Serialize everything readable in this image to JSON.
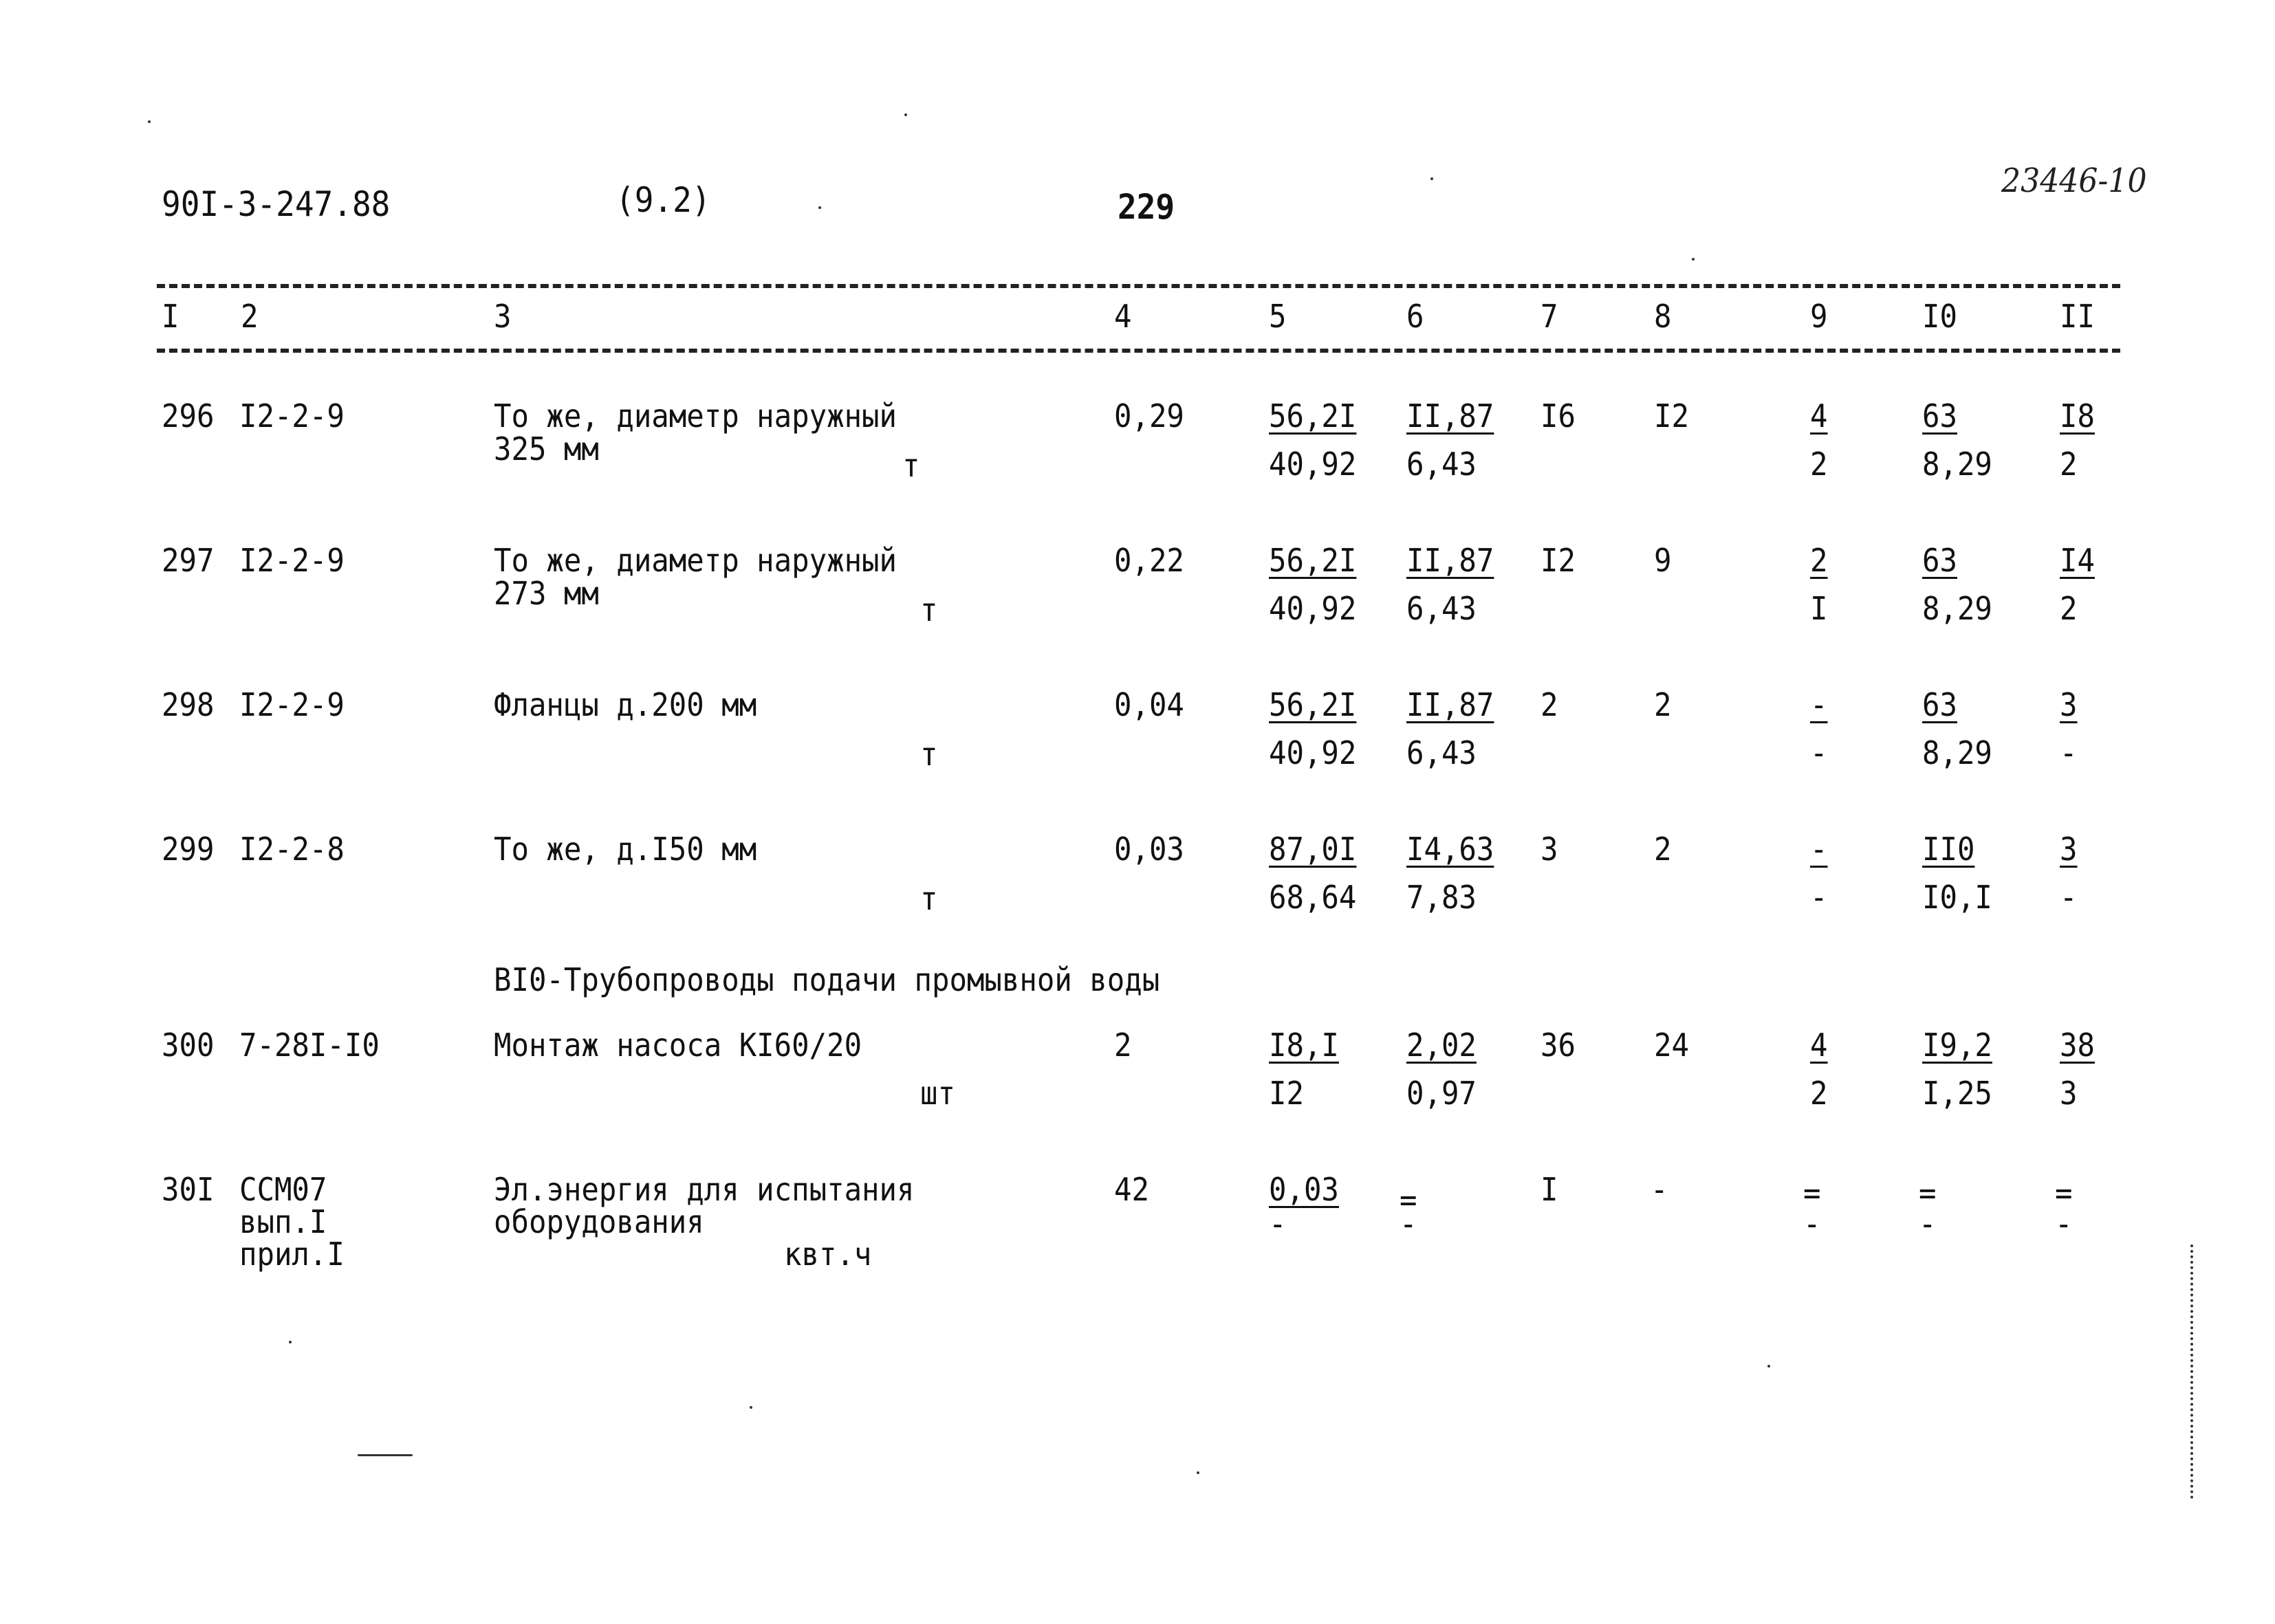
{
  "document": {
    "code": "90I-3-247.88",
    "section_ref": "(9.2)",
    "page_number": "229",
    "stamp": "23446-10"
  },
  "columns": [
    "I",
    "2",
    "3",
    "4",
    "5",
    "6",
    "7",
    "8",
    "9",
    "I0",
    "II"
  ],
  "rows": [
    {
      "num": "296",
      "ref": [
        "I2-2-9"
      ],
      "desc": [
        "То же, диаметр наружный",
        "325 мм"
      ],
      "unit": "т",
      "qty": "0,29",
      "c5": [
        "56,2I",
        "40,92"
      ],
      "c6": [
        "II,87",
        "6,43"
      ],
      "c7": "I6",
      "c8": "I2",
      "c9": [
        "4",
        "2"
      ],
      "c10": [
        "63",
        "8,29"
      ],
      "c11": [
        "I8",
        "2"
      ]
    },
    {
      "num": "297",
      "ref": [
        "I2-2-9"
      ],
      "desc": [
        "То же, диаметр наружный",
        "273 мм"
      ],
      "unit": "т",
      "qty": "0,22",
      "c5": [
        "56,2I",
        "40,92"
      ],
      "c6": [
        "II,87",
        "6,43"
      ],
      "c7": "I2",
      "c8": "9",
      "c9": [
        "2",
        "I"
      ],
      "c10": [
        "63",
        "8,29"
      ],
      "c11": [
        "I4",
        "2"
      ]
    },
    {
      "num": "298",
      "ref": [
        "I2-2-9"
      ],
      "desc": [
        "Фланцы д.200 мм"
      ],
      "unit": "т",
      "qty": "0,04",
      "c5": [
        "56,2I",
        "40,92"
      ],
      "c6": [
        "II,87",
        "6,43"
      ],
      "c7": "2",
      "c8": "2",
      "c9": [
        "-",
        "-"
      ],
      "c10": [
        "63",
        "8,29"
      ],
      "c11": [
        "3",
        "-"
      ]
    },
    {
      "num": "299",
      "ref": [
        "I2-2-8"
      ],
      "desc": [
        "То же, д.I50 мм"
      ],
      "unit": "т",
      "qty": "0,03",
      "c5": [
        "87,0I",
        "68,64"
      ],
      "c6": [
        "I4,63",
        "7,83"
      ],
      "c7": "3",
      "c8": "2",
      "c9": [
        "-",
        "-"
      ],
      "c10": [
        "II0",
        "I0,I"
      ],
      "c11": [
        "3",
        "-"
      ]
    },
    {
      "section": "BI0-Трубопроводы подачи промывной воды"
    },
    {
      "num": "300",
      "ref": [
        "7-28I-I0"
      ],
      "desc": [
        "Монтаж насоса КI60/20"
      ],
      "unit": "шт",
      "qty": "2",
      "c5": [
        "I8,I",
        "I2"
      ],
      "c6": [
        "2,02",
        "0,97"
      ],
      "c7": "36",
      "c8": "24",
      "c9": [
        "4",
        "2"
      ],
      "c10": [
        "I9,2",
        "I,25"
      ],
      "c11": [
        "38",
        "3"
      ]
    },
    {
      "num": "30I",
      "ref": [
        "ССМ07",
        "вып.I",
        "прил.I"
      ],
      "desc": [
        "Эл.энергия для испытания",
        "оборудования"
      ],
      "unit": "квт.ч",
      "qty": "42",
      "c5": [
        "0,03",
        "-"
      ],
      "c6": [
        "=",
        "-"
      ],
      "c7": "I",
      "c8": "-",
      "c9": [
        "=",
        "-"
      ],
      "c10": [
        "=",
        "-"
      ],
      "c11": [
        "=",
        "-"
      ]
    }
  ]
}
